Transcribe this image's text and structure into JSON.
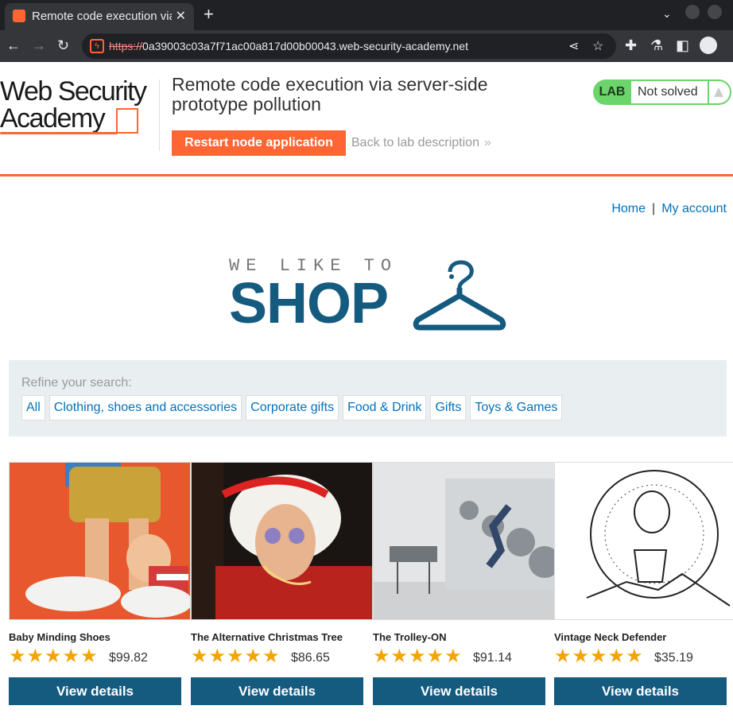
{
  "browser": {
    "tab_title": "Remote code execution via server-side prototype pollution",
    "url_scheme": "https://",
    "url_host": "0a39003c03a7f71ac00a817d00b00043.web-security-academy.net"
  },
  "lab_header": {
    "logo_line1": "Web Security",
    "logo_line2": "Academy",
    "title": "Remote code execution via server-side prototype pollution",
    "restart_label": "Restart node application",
    "back_label": "Back to lab description",
    "badge": "LAB",
    "status": "Not solved"
  },
  "nav": {
    "home": "Home",
    "separator": "|",
    "account": "My account"
  },
  "shop_logo": {
    "tagline": "WE LIKE TO",
    "word": "SHOP"
  },
  "refine": {
    "label": "Refine your search:",
    "items": [
      "All",
      "Clothing, shoes and accessories",
      "Corporate gifts",
      "Food & Drink",
      "Gifts",
      "Toys & Games"
    ]
  },
  "products": [
    {
      "name": "Baby Minding Shoes",
      "rating": 5,
      "stars": "★★★★★",
      "price": "$99.82",
      "button": "View details"
    },
    {
      "name": "The Alternative Christmas Tree",
      "rating": 5,
      "stars": "★★★★★",
      "price": "$86.65",
      "button": "View details"
    },
    {
      "name": "The Trolley-ON",
      "rating": 5,
      "stars": "★★★★★",
      "price": "$91.14",
      "button": "View details"
    },
    {
      "name": "Vintage Neck Defender",
      "rating": 5,
      "stars": "★★★★★",
      "price": "$35.19",
      "button": "View details"
    }
  ],
  "colors": {
    "accent": "#ff6633",
    "link": "#0071bc",
    "button": "#155a7f",
    "lab_green": "#6bd46a",
    "star": "#f5a300"
  }
}
